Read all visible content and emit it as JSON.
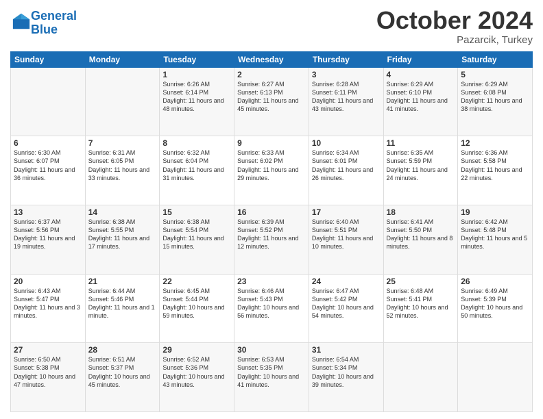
{
  "header": {
    "logo_line1": "General",
    "logo_line2": "Blue",
    "month": "October 2024",
    "location": "Pazarcik, Turkey"
  },
  "weekdays": [
    "Sunday",
    "Monday",
    "Tuesday",
    "Wednesday",
    "Thursday",
    "Friday",
    "Saturday"
  ],
  "rows": [
    [
      {
        "day": "",
        "text": ""
      },
      {
        "day": "",
        "text": ""
      },
      {
        "day": "1",
        "text": "Sunrise: 6:26 AM\nSunset: 6:14 PM\nDaylight: 11 hours and 48 minutes."
      },
      {
        "day": "2",
        "text": "Sunrise: 6:27 AM\nSunset: 6:13 PM\nDaylight: 11 hours and 45 minutes."
      },
      {
        "day": "3",
        "text": "Sunrise: 6:28 AM\nSunset: 6:11 PM\nDaylight: 11 hours and 43 minutes."
      },
      {
        "day": "4",
        "text": "Sunrise: 6:29 AM\nSunset: 6:10 PM\nDaylight: 11 hours and 41 minutes."
      },
      {
        "day": "5",
        "text": "Sunrise: 6:29 AM\nSunset: 6:08 PM\nDaylight: 11 hours and 38 minutes."
      }
    ],
    [
      {
        "day": "6",
        "text": "Sunrise: 6:30 AM\nSunset: 6:07 PM\nDaylight: 11 hours and 36 minutes."
      },
      {
        "day": "7",
        "text": "Sunrise: 6:31 AM\nSunset: 6:05 PM\nDaylight: 11 hours and 33 minutes."
      },
      {
        "day": "8",
        "text": "Sunrise: 6:32 AM\nSunset: 6:04 PM\nDaylight: 11 hours and 31 minutes."
      },
      {
        "day": "9",
        "text": "Sunrise: 6:33 AM\nSunset: 6:02 PM\nDaylight: 11 hours and 29 minutes."
      },
      {
        "day": "10",
        "text": "Sunrise: 6:34 AM\nSunset: 6:01 PM\nDaylight: 11 hours and 26 minutes."
      },
      {
        "day": "11",
        "text": "Sunrise: 6:35 AM\nSunset: 5:59 PM\nDaylight: 11 hours and 24 minutes."
      },
      {
        "day": "12",
        "text": "Sunrise: 6:36 AM\nSunset: 5:58 PM\nDaylight: 11 hours and 22 minutes."
      }
    ],
    [
      {
        "day": "13",
        "text": "Sunrise: 6:37 AM\nSunset: 5:56 PM\nDaylight: 11 hours and 19 minutes."
      },
      {
        "day": "14",
        "text": "Sunrise: 6:38 AM\nSunset: 5:55 PM\nDaylight: 11 hours and 17 minutes."
      },
      {
        "day": "15",
        "text": "Sunrise: 6:38 AM\nSunset: 5:54 PM\nDaylight: 11 hours and 15 minutes."
      },
      {
        "day": "16",
        "text": "Sunrise: 6:39 AM\nSunset: 5:52 PM\nDaylight: 11 hours and 12 minutes."
      },
      {
        "day": "17",
        "text": "Sunrise: 6:40 AM\nSunset: 5:51 PM\nDaylight: 11 hours and 10 minutes."
      },
      {
        "day": "18",
        "text": "Sunrise: 6:41 AM\nSunset: 5:50 PM\nDaylight: 11 hours and 8 minutes."
      },
      {
        "day": "19",
        "text": "Sunrise: 6:42 AM\nSunset: 5:48 PM\nDaylight: 11 hours and 5 minutes."
      }
    ],
    [
      {
        "day": "20",
        "text": "Sunrise: 6:43 AM\nSunset: 5:47 PM\nDaylight: 11 hours and 3 minutes."
      },
      {
        "day": "21",
        "text": "Sunrise: 6:44 AM\nSunset: 5:46 PM\nDaylight: 11 hours and 1 minute."
      },
      {
        "day": "22",
        "text": "Sunrise: 6:45 AM\nSunset: 5:44 PM\nDaylight: 10 hours and 59 minutes."
      },
      {
        "day": "23",
        "text": "Sunrise: 6:46 AM\nSunset: 5:43 PM\nDaylight: 10 hours and 56 minutes."
      },
      {
        "day": "24",
        "text": "Sunrise: 6:47 AM\nSunset: 5:42 PM\nDaylight: 10 hours and 54 minutes."
      },
      {
        "day": "25",
        "text": "Sunrise: 6:48 AM\nSunset: 5:41 PM\nDaylight: 10 hours and 52 minutes."
      },
      {
        "day": "26",
        "text": "Sunrise: 6:49 AM\nSunset: 5:39 PM\nDaylight: 10 hours and 50 minutes."
      }
    ],
    [
      {
        "day": "27",
        "text": "Sunrise: 6:50 AM\nSunset: 5:38 PM\nDaylight: 10 hours and 47 minutes."
      },
      {
        "day": "28",
        "text": "Sunrise: 6:51 AM\nSunset: 5:37 PM\nDaylight: 10 hours and 45 minutes."
      },
      {
        "day": "29",
        "text": "Sunrise: 6:52 AM\nSunset: 5:36 PM\nDaylight: 10 hours and 43 minutes."
      },
      {
        "day": "30",
        "text": "Sunrise: 6:53 AM\nSunset: 5:35 PM\nDaylight: 10 hours and 41 minutes."
      },
      {
        "day": "31",
        "text": "Sunrise: 6:54 AM\nSunset: 5:34 PM\nDaylight: 10 hours and 39 minutes."
      },
      {
        "day": "",
        "text": ""
      },
      {
        "day": "",
        "text": ""
      }
    ]
  ]
}
